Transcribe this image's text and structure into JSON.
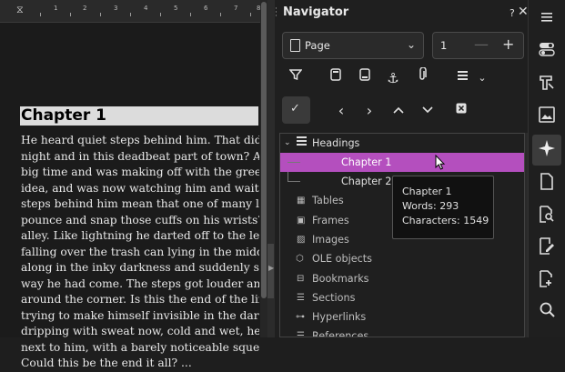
{
  "document": {
    "heading": "Chapter 1",
    "lines": [
      "He heard quiet steps behind him. That didn't boo",
      "night and in this deadbeat part of town? And at",
      "big time and was making off with the greenback",
      "idea, and was now watching him and waiting for",
      "steps behind him mean that one of many law of",
      "pounce and snap those cuffs on his wrists? He r",
      "alley. Like lightning he darted off to the left and",
      "falling over the trash can lying in the middle of",
      "along in the inky darkness and suddenly stiffene",
      "way he had come. The steps got louder and loud",
      "around the corner. Is this the end of the line? he",
      "trying to make himself invisible in the dark, wa",
      "dripping with sweat now, cold and wet, he coul",
      "next to him, with a barely noticeable squeak, a d",
      "Could this be the end it all? ..."
    ],
    "ruler_numbers": [
      "1",
      "2",
      "3",
      "4",
      "5",
      "6",
      "7",
      "8"
    ]
  },
  "navigator": {
    "title": "Navigator",
    "help": "?",
    "close": "✕",
    "type_select": "Page",
    "page_value": "1",
    "minus": "—",
    "plus": "+",
    "tree": {
      "headings_label": "Headings",
      "chapter1": "Chapter 1",
      "chapter2": "Chapter 2",
      "categories": [
        "Tables",
        "Frames",
        "Images",
        "OLE objects",
        "Bookmarks",
        "Sections",
        "Hyperlinks",
        "References"
      ]
    },
    "tooltip": {
      "line1": "Chapter 1",
      "line2": "Words: 293",
      "line3": "Characters: 1549"
    },
    "highlight_color": "#b44fbe"
  },
  "sidebar": {
    "icons": [
      "menu-icon",
      "toggle-icon",
      "styles-icon",
      "gallery-icon",
      "navigator-icon",
      "page-icon",
      "find-icon",
      "manage-changes-icon",
      "design-icon",
      "search-icon"
    ]
  }
}
